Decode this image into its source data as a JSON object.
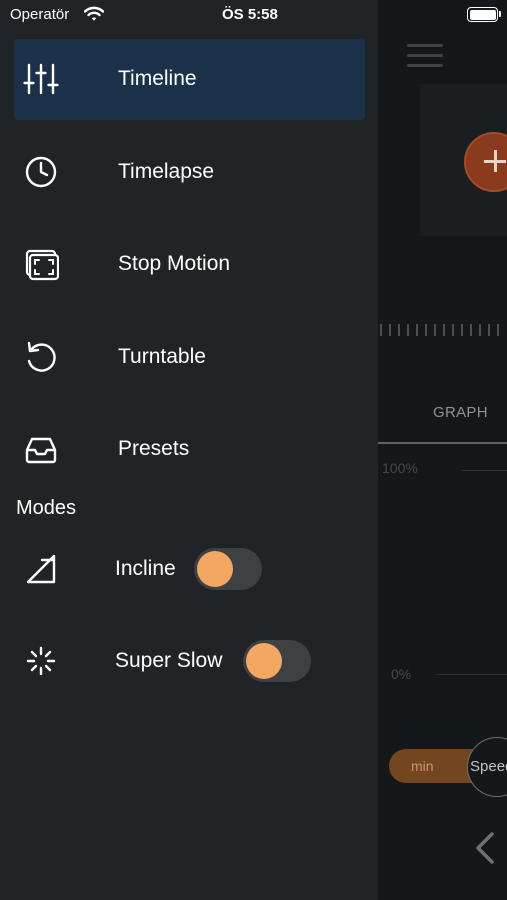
{
  "status_bar": {
    "carrier": "Operatör",
    "time": "ÖS 5:58"
  },
  "menu": {
    "items": [
      {
        "label": "Timeline",
        "icon": "sliders-icon",
        "active": true
      },
      {
        "label": "Timelapse",
        "icon": "clock-icon",
        "active": false
      },
      {
        "label": "Stop Motion",
        "icon": "frame-icon",
        "active": false
      },
      {
        "label": "Turntable",
        "icon": "rotate-icon",
        "active": false
      },
      {
        "label": "Presets",
        "icon": "inbox-icon",
        "active": false
      }
    ]
  },
  "modes": {
    "title": "Modes",
    "items": [
      {
        "label": "Incline",
        "icon": "incline-icon",
        "enabled": false
      },
      {
        "label": "Super Slow",
        "icon": "spinner-icon",
        "enabled": false
      }
    ]
  },
  "background": {
    "graph_tab": "GRAPH",
    "pct_top": "100%",
    "pct_bottom": "0%",
    "min_label": "min",
    "speed_label": "Speed"
  },
  "colors": {
    "drawer_bg": "#212427",
    "active_item_bg": "#1b3049",
    "toggle_knob": "#f2a863",
    "toggle_track": "#3d4144",
    "fab": "#8a3b1d"
  }
}
